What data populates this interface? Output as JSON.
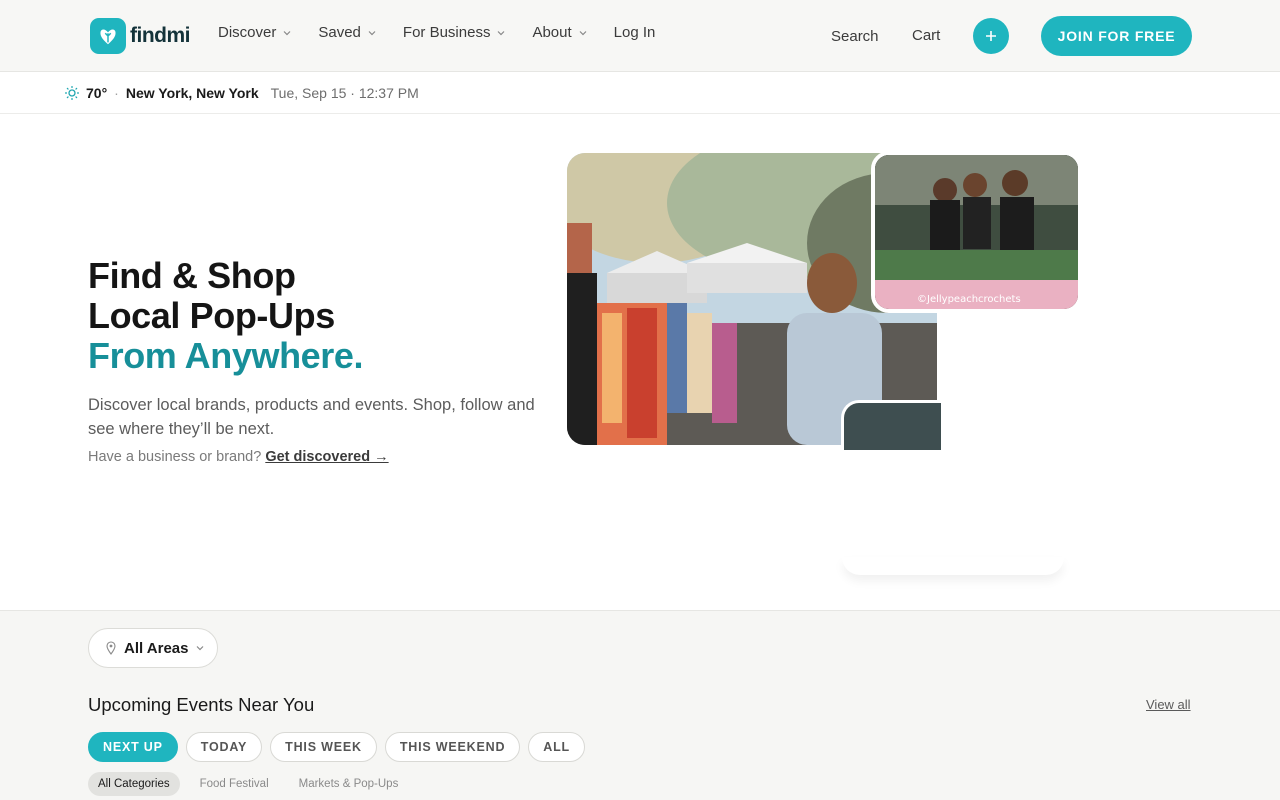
{
  "header": {
    "logo_text": "findmi",
    "nav": [
      {
        "label": "Discover"
      },
      {
        "label": "Saved"
      },
      {
        "label": "For Business"
      },
      {
        "label": "About"
      }
    ],
    "login_label": "Log In",
    "search_label": "Search",
    "cart_label": "Cart",
    "join_label": "JOIN FOR FREE",
    "icons": {
      "logo": "heart-leaf-logo-icon",
      "add": "plus-icon",
      "dropdown": "chevron-down-icon"
    }
  },
  "weather": {
    "temp": "70°",
    "city": "New York, New York",
    "date": "Tue, Sep 15 · 12:37 PM",
    "icon": "sun-icon"
  },
  "hero": {
    "title_line1": "Find & Shop",
    "title_line2": "Local Pop-Ups",
    "title_accent": "From Anywhere.",
    "subtitle": "Discover local brands, products and events. Shop, follow and see where they’ll be next.",
    "biz_prompt": "Have a business or brand?",
    "biz_link": "Get discovered →",
    "photo_caption": "©Jellypeachcrochets"
  },
  "events": {
    "area_label": "All Areas",
    "title": "Upcoming Events Near You",
    "view_all": "View all",
    "filters": [
      {
        "label": "NEXT UP",
        "active": true
      },
      {
        "label": "TODAY",
        "active": false
      },
      {
        "label": "THIS WEEK",
        "active": false
      },
      {
        "label": "THIS WEEKEND",
        "active": false
      },
      {
        "label": "ALL",
        "active": false
      }
    ],
    "categories": [
      {
        "label": "All Categories",
        "active": true
      },
      {
        "label": "Food Festival",
        "active": false
      },
      {
        "label": "Markets & Pop-Ups",
        "active": false
      }
    ]
  },
  "colors": {
    "accent": "#1fb5bf",
    "accent_text": "#178f99"
  }
}
